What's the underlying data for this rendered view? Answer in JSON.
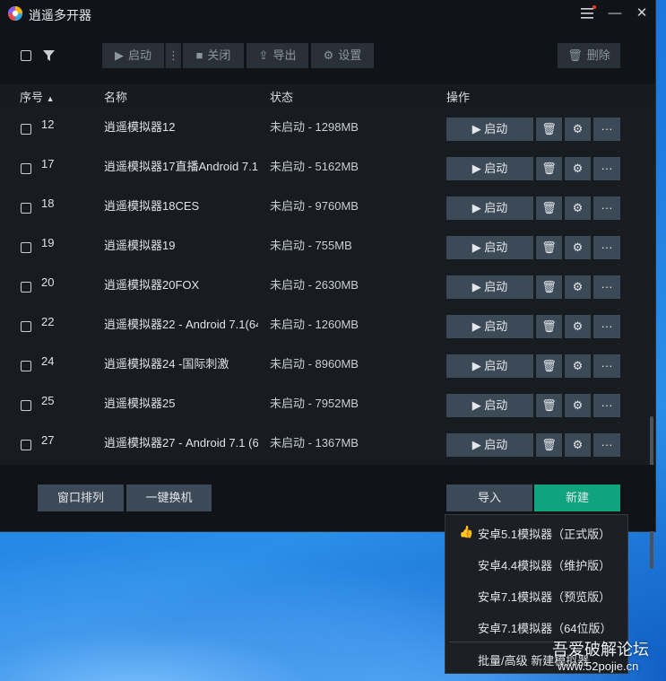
{
  "window": {
    "title": "逍遥多开器"
  },
  "titlebar": {
    "menu_icon": "hamburger-menu-icon",
    "minimize": "—",
    "close": "✕"
  },
  "toolbar": {
    "start": "启动",
    "close": "关闭",
    "export": "导出",
    "settings": "设置",
    "delete": "删除",
    "more": "⋮"
  },
  "table": {
    "headers": {
      "id": "序号",
      "sort_arrow": "▲",
      "name": "名称",
      "status": "状态",
      "ops": "操作"
    },
    "start_label": "启动",
    "rows": [
      {
        "id": "12",
        "name": "逍遥模拟器12",
        "status": "未启动 - 1298MB"
      },
      {
        "id": "17",
        "name": "逍遥模拟器17直播Android 7.1",
        "status": "未启动 - 5162MB"
      },
      {
        "id": "18",
        "name": "逍遥模拟器18CES",
        "status": "未启动 - 9760MB"
      },
      {
        "id": "19",
        "name": "逍遥模拟器19",
        "status": "未启动 - 755MB"
      },
      {
        "id": "20",
        "name": "逍遥模拟器20FOX",
        "status": "未启动 - 2630MB"
      },
      {
        "id": "22",
        "name": "逍遥模拟器22 - Android 7.1(64",
        "status": "未启动 - 1260MB"
      },
      {
        "id": "24",
        "name": "逍遥模拟器24 -国际刺激",
        "status": "未启动 - 8960MB"
      },
      {
        "id": "25",
        "name": "逍遥模拟器25",
        "status": "未启动 - 7952MB"
      },
      {
        "id": "27",
        "name": "逍遥模拟器27 - Android 7.1 (6",
        "status": "未启动 - 1367MB"
      }
    ]
  },
  "footer": {
    "arrange": "窗口排列",
    "switch": "一键换机",
    "import": "导入",
    "new": "新建"
  },
  "new_menu": {
    "items": [
      "安卓5.1模拟器（正式版）",
      "安卓4.4模拟器（维护版）",
      "安卓7.1模拟器（预览版）",
      "安卓7.1模拟器（64位版）",
      "批量/高级 新建模拟器"
    ]
  },
  "watermark": {
    "line1": "吾爱破解论坛",
    "line2": "www.52pojie.cn"
  },
  "colors": {
    "accent_green": "#0fa47d",
    "row_button": "#3b4a56",
    "window_bg": "#101418"
  }
}
